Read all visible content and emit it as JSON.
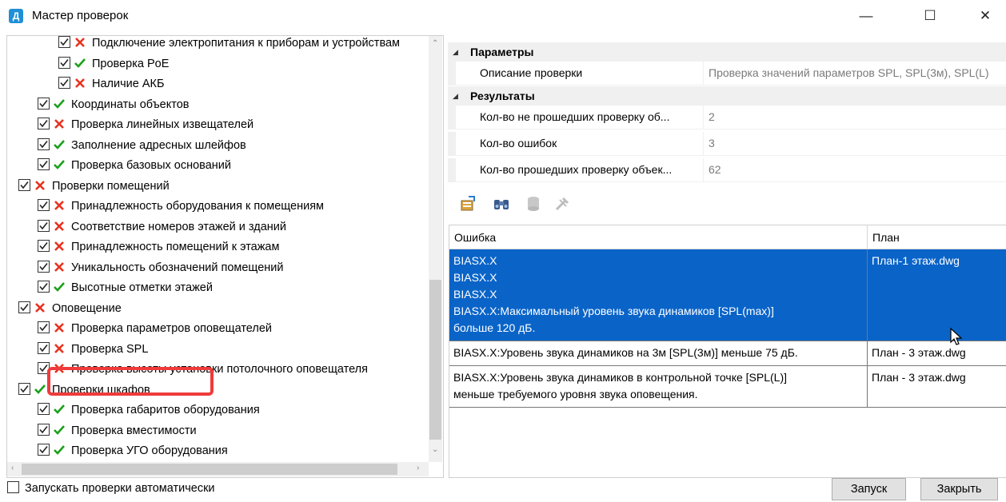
{
  "window": {
    "title": "Мастер проверок",
    "app_icon": "Д",
    "controls": {
      "minimize": "—",
      "maximize": "☐",
      "close": "✕"
    }
  },
  "tree": {
    "rows": [
      {
        "label": "Подключение электропитания к приборам и устройствам",
        "status": "fail",
        "level": 2
      },
      {
        "label": "Проверка PoE",
        "status": "ok",
        "level": 2
      },
      {
        "label": "Наличие АКБ",
        "status": "fail",
        "level": 2
      },
      {
        "label": "Координаты объектов",
        "status": "ok",
        "level": 1
      },
      {
        "label": "Проверка линейных извещателей",
        "status": "fail",
        "level": 1
      },
      {
        "label": "Заполнение адресных шлейфов",
        "status": "ok",
        "level": 1
      },
      {
        "label": "Проверка базовых оснований",
        "status": "ok",
        "level": 1
      },
      {
        "label": "Проверки помещений",
        "status": "fail",
        "level": 0,
        "expanded": true
      },
      {
        "label": "Принадлежность оборудования к помещениям",
        "status": "fail",
        "level": 1
      },
      {
        "label": "Соответствие номеров этажей и зданий",
        "status": "fail",
        "level": 1
      },
      {
        "label": "Принадлежность помещений к этажам",
        "status": "fail",
        "level": 1
      },
      {
        "label": "Уникальность обозначений помещений",
        "status": "fail",
        "level": 1
      },
      {
        "label": "Высотные отметки этажей",
        "status": "ok",
        "level": 1
      },
      {
        "label": "Оповещение",
        "status": "fail",
        "level": 0,
        "expanded": true
      },
      {
        "label": "Проверка параметров оповещателей",
        "status": "fail",
        "level": 1
      },
      {
        "label": "Проверка SPL",
        "status": "fail",
        "level": 1,
        "highlighted": true
      },
      {
        "label": "Проверка высоты установки потолочного оповещателя",
        "status": "fail",
        "level": 1
      },
      {
        "label": "Проверки шкафов",
        "status": "ok",
        "level": 0,
        "expanded": true
      },
      {
        "label": "Проверка габаритов оборудования",
        "status": "ok",
        "level": 1
      },
      {
        "label": "Проверка вместимости",
        "status": "ok",
        "level": 1
      },
      {
        "label": "Проверка УГО оборудования",
        "status": "ok",
        "level": 1
      }
    ]
  },
  "properties": {
    "params_title": "Параметры",
    "params": [
      {
        "name": "Описание проверки",
        "value": "Проверка значений параметров SPL, SPL(3м), SPL(L)"
      }
    ],
    "results_title": "Результаты",
    "results": [
      {
        "name": "Кол-во не прошедших проверку об...",
        "value": "2"
      },
      {
        "name": "Кол-во ошибок",
        "value": "3"
      },
      {
        "name": "Кол-во прошедших проверку объек...",
        "value": "62"
      }
    ]
  },
  "toolbar_icons": [
    "properties-icon",
    "binoculars-icon",
    "database-icon",
    "tools-icon"
  ],
  "grid": {
    "headers": [
      "Ошибка",
      "План"
    ],
    "rows": [
      {
        "error_lines": [
          "BIASX.X",
          "BIASX.X",
          "BIASX.X",
          "BIASX.X:Максимальный уровень звука динамиков [SPL(max)]",
          "больше 120 дБ."
        ],
        "plan": "План-1 этаж.dwg",
        "selected": true
      },
      {
        "error_lines": [
          "BIASX.X:Уровень звука динамиков на 3м [SPL(3м)] меньше 75 дБ."
        ],
        "plan": "План - 3 этаж.dwg",
        "selected": false
      },
      {
        "error_lines": [
          "BIASX.X:Уровень звука динамиков в контрольной точке [SPL(L)]",
          "меньше требуемого уровня звука оповещения."
        ],
        "plan": "План - 3 этаж.dwg",
        "selected": false
      }
    ]
  },
  "footer": {
    "auto_run_label": "Запускать проверки автоматически",
    "auto_run_checked": false,
    "run_button": "Запуск",
    "close_button": "Закрыть"
  },
  "colors": {
    "selection": "#0a64c8",
    "ok": "#1aa01a",
    "fail": "#e8321e",
    "highlight": "#ef3b3b"
  }
}
